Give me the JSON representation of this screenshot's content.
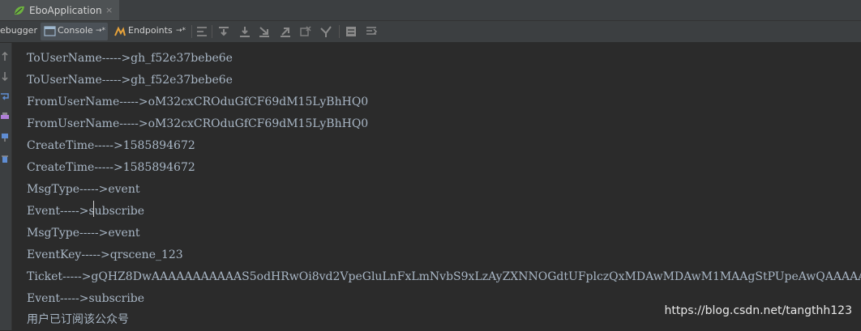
{
  "tab": {
    "label": "EboApplication",
    "close": "×"
  },
  "toolbar": {
    "debugger_label": "ebugger",
    "console_label": "Console",
    "console_pin": "→*",
    "endpoints_label": "Endpoints",
    "endpoints_pin": "→*"
  },
  "console": {
    "lines": [
      "ToUserName----->gh_f52e37bebe6e",
      "ToUserName----->gh_f52e37bebe6e",
      "FromUserName----->oM32cxCROduGfCF69dM15LyBhHQ0",
      "FromUserName----->oM32cxCROduGfCF69dM15LyBhHQ0",
      "CreateTime----->1585894672",
      "CreateTime----->1585894672",
      "MsgType----->event",
      "Event----->subscribe",
      "MsgType----->event",
      "EventKey----->qrscene_123",
      "Ticket----->gQHZ8DwAAAAAAAAAAAS5odHRwOi8vd2VpeGluLnFxLmNvbS9xLzAyZXNNOGdtUFplczQxMDAwMDAwM1MAAgStPUpeAwQAAAAA",
      "Event----->subscribe",
      "用户已订阅该公众号"
    ]
  },
  "watermark": "https://blog.csdn.net/tangthh123",
  "colors": {
    "console_bg": "#2b2b2b",
    "console_text": "#a9b7c6",
    "toolbar_bg": "#3c3f41"
  }
}
